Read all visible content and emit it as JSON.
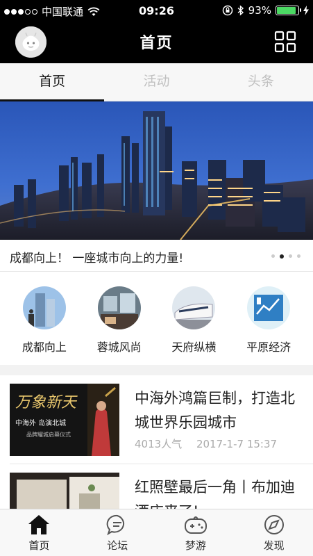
{
  "status_bar": {
    "carrier": "中国联通",
    "time": "09:26",
    "battery_percent": "93%",
    "battery_level": 0.93,
    "signal_bars_filled": 3,
    "signal_bars_total": 5
  },
  "nav": {
    "title": "首页",
    "avatar_icon": "user-avatar-icon",
    "menu_icon": "grid-icon"
  },
  "tabs": [
    {
      "label": "首页",
      "active": true
    },
    {
      "label": "活动",
      "active": false
    },
    {
      "label": "头条",
      "active": false
    }
  ],
  "banner": {
    "caption": "成都向上！ 一座城市向上的力量!",
    "page_count": 4,
    "current_page": 2
  },
  "categories": [
    {
      "label": "成都向上"
    },
    {
      "label": "蓉城风尚"
    },
    {
      "label": "天府纵横"
    },
    {
      "label": "平原经济"
    }
  ],
  "articles": [
    {
      "title": "中海外鸿篇巨制，打造北城世界乐园城市",
      "views": "4013人气",
      "date": "2017-1-7 15:37",
      "thumb_text_main": "万象新天",
      "thumb_text_sub": "中海外 岛演北城",
      "thumb_text_small": "品牌耀城启幕仪式"
    },
    {
      "title": "红照壁最后一角丨布加迪酒店来了!",
      "views": "",
      "date": ""
    }
  ],
  "bottom_nav": [
    {
      "label": "首页",
      "icon": "home-icon",
      "active": true
    },
    {
      "label": "论坛",
      "icon": "chat-icon",
      "active": false
    },
    {
      "label": "梦游",
      "icon": "gamepad-icon",
      "active": false
    },
    {
      "label": "发现",
      "icon": "compass-icon",
      "active": false
    }
  ],
  "colors": {
    "header_bg": "#000000",
    "accent": "#111111",
    "battery_green": "#4cd964",
    "inactive_tab": "#c0c0c0",
    "meta_text": "#aaaaaa"
  }
}
